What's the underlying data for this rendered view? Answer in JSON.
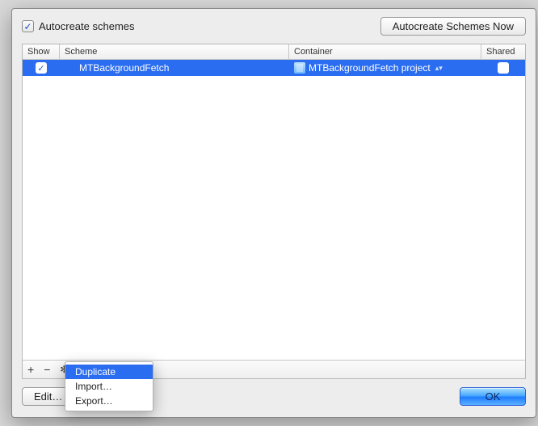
{
  "header": {
    "autocreate_label": "Autocreate schemes",
    "autocreate_checked": true,
    "autocreate_now_label": "Autocreate Schemes Now"
  },
  "table": {
    "columns": {
      "show": "Show",
      "scheme": "Scheme",
      "container": "Container",
      "shared": "Shared"
    },
    "rows": [
      {
        "show_checked": true,
        "scheme": "MTBackgroundFetch",
        "container": "MTBackgroundFetch project",
        "shared_checked": false,
        "selected": true
      }
    ]
  },
  "footer_icons": {
    "add": "+",
    "remove": "−",
    "gear": "✻▾"
  },
  "context_menu": {
    "items": [
      {
        "label": "Duplicate",
        "highlighted": true
      },
      {
        "label": "Import…",
        "highlighted": false
      },
      {
        "label": "Export…",
        "highlighted": false
      }
    ]
  },
  "bottom": {
    "edit_label": "Edit…",
    "ok_label": "OK"
  }
}
